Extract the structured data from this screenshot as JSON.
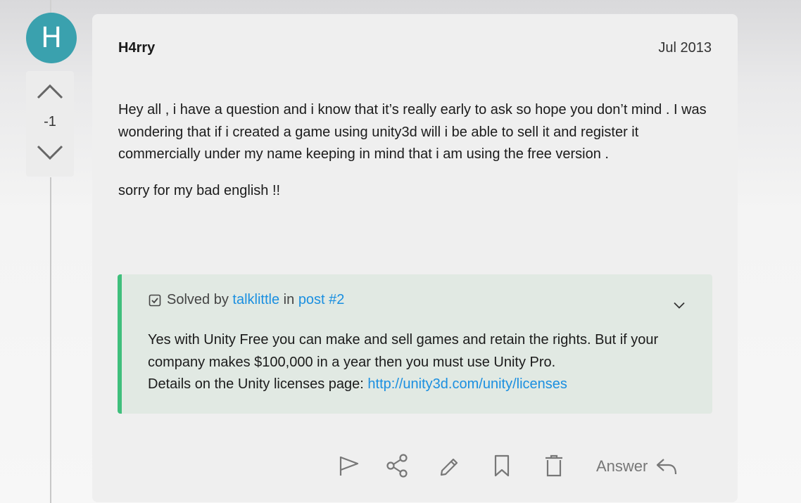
{
  "post": {
    "avatar_letter": "H",
    "author": "H4rry",
    "date": "Jul 2013",
    "vote_count": "-1",
    "paragraphs": [
      "Hey all , i have a question and i know that it’s really early to ask so hope you don’t mind . I was wondering that if i created a game using unity3d will i be able to sell it and register it commercially under my name keeping in mind that i am using the free version .",
      "sorry for my bad english !!"
    ]
  },
  "solution": {
    "prefix": "Solved by",
    "solver": "talklittle",
    "in_word": "in",
    "post_link": "post #2",
    "line1": "Yes with Unity Free you can make and sell games and retain the rights. But if your company makes $100,000 in a year then you must use Unity Pro.",
    "line2_prefix": "Details on the Unity licenses page: ",
    "url": "http://unity3d.com/unity/licenses"
  },
  "actions": {
    "answer_label": "Answer",
    "icons": [
      "flag-icon",
      "share-icon",
      "edit-icon",
      "bookmark-icon",
      "delete-icon",
      "reply-icon"
    ]
  },
  "colors": {
    "avatar": "#3aa1ae",
    "accent_link": "#1a8fe0",
    "solution_bar": "#3fbf7c",
    "solution_bg": "#e1e9e3"
  }
}
